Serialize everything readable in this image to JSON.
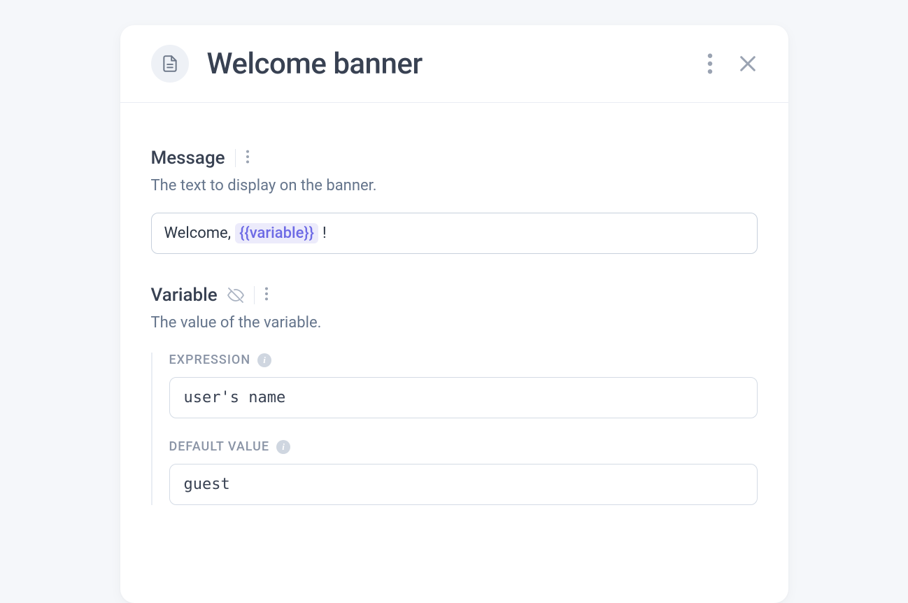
{
  "header": {
    "title": "Welcome banner",
    "icon": "document-icon"
  },
  "sections": {
    "message": {
      "title": "Message",
      "description": "The text to display on the banner.",
      "value_prefix": "Welcome, ",
      "variable_token": "{{variable}}",
      "value_suffix": " !"
    },
    "variable": {
      "title": "Variable",
      "description": "The value of the variable.",
      "fields": {
        "expression": {
          "label": "EXPRESSION",
          "value": "user's name"
        },
        "default_value": {
          "label": "DEFAULT VALUE",
          "value": "guest"
        }
      }
    }
  }
}
